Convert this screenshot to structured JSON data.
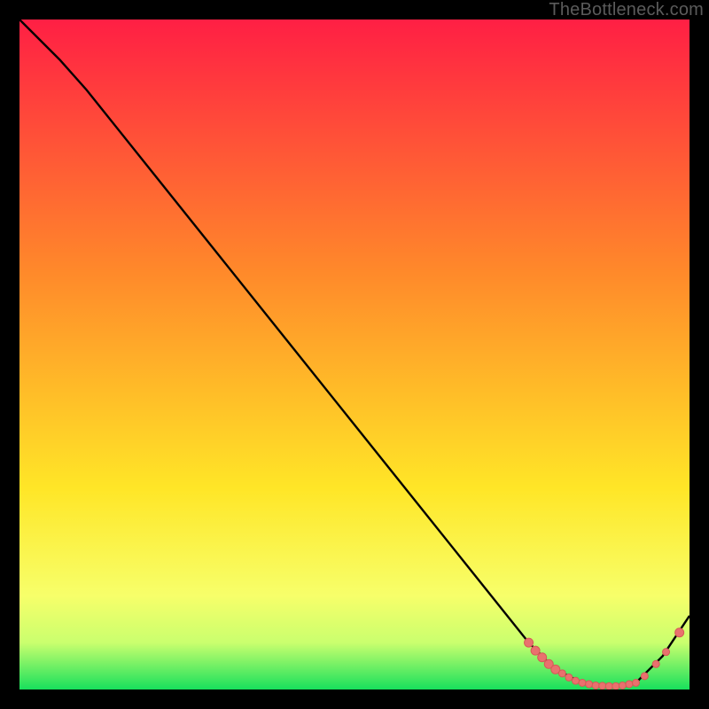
{
  "watermark": "TheBottleneck.com",
  "colors": {
    "gradient_top": "#ff1f44",
    "gradient_mid_hi": "#ff8a2a",
    "gradient_mid": "#ffe627",
    "gradient_lo": "#f7ff6a",
    "gradient_lower": "#caff6e",
    "gradient_bottom": "#18e05c",
    "curve_stroke": "#000000",
    "marker_fill": "#e9716e",
    "marker_stroke": "#d65a57"
  },
  "chart_data": {
    "type": "line",
    "title": "",
    "xlabel": "",
    "ylabel": "",
    "xlim": [
      0,
      100
    ],
    "ylim": [
      0,
      100
    ],
    "grid": false,
    "legend": false,
    "series": [
      {
        "name": "curve",
        "x": [
          0,
          6,
          10,
          20,
          30,
          40,
          50,
          60,
          70,
          76,
          80,
          84,
          88,
          92,
          96,
          100
        ],
        "y": [
          100,
          94,
          89.5,
          77,
          64.5,
          52,
          39.5,
          27,
          14.5,
          7,
          3,
          1,
          0.5,
          1,
          5,
          11
        ]
      }
    ],
    "markers": [
      {
        "x": 76.0,
        "y": 7.0,
        "r": 5
      },
      {
        "x": 77.0,
        "y": 5.8,
        "r": 5
      },
      {
        "x": 78.0,
        "y": 4.8,
        "r": 5
      },
      {
        "x": 79.0,
        "y": 3.8,
        "r": 5
      },
      {
        "x": 80.0,
        "y": 3.0,
        "r": 5
      },
      {
        "x": 81.0,
        "y": 2.4,
        "r": 4
      },
      {
        "x": 82.0,
        "y": 1.8,
        "r": 4
      },
      {
        "x": 83.0,
        "y": 1.3,
        "r": 4
      },
      {
        "x": 84.0,
        "y": 1.0,
        "r": 4
      },
      {
        "x": 85.0,
        "y": 0.8,
        "r": 4
      },
      {
        "x": 86.0,
        "y": 0.6,
        "r": 4
      },
      {
        "x": 87.0,
        "y": 0.55,
        "r": 4
      },
      {
        "x": 88.0,
        "y": 0.5,
        "r": 4
      },
      {
        "x": 89.0,
        "y": 0.5,
        "r": 4
      },
      {
        "x": 90.0,
        "y": 0.6,
        "r": 4
      },
      {
        "x": 91.0,
        "y": 0.8,
        "r": 4
      },
      {
        "x": 92.0,
        "y": 1.0,
        "r": 4
      },
      {
        "x": 93.3,
        "y": 2.0,
        "r": 4
      },
      {
        "x": 95.0,
        "y": 3.8,
        "r": 4
      },
      {
        "x": 96.5,
        "y": 5.6,
        "r": 4
      },
      {
        "x": 98.5,
        "y": 8.5,
        "r": 5
      }
    ]
  }
}
